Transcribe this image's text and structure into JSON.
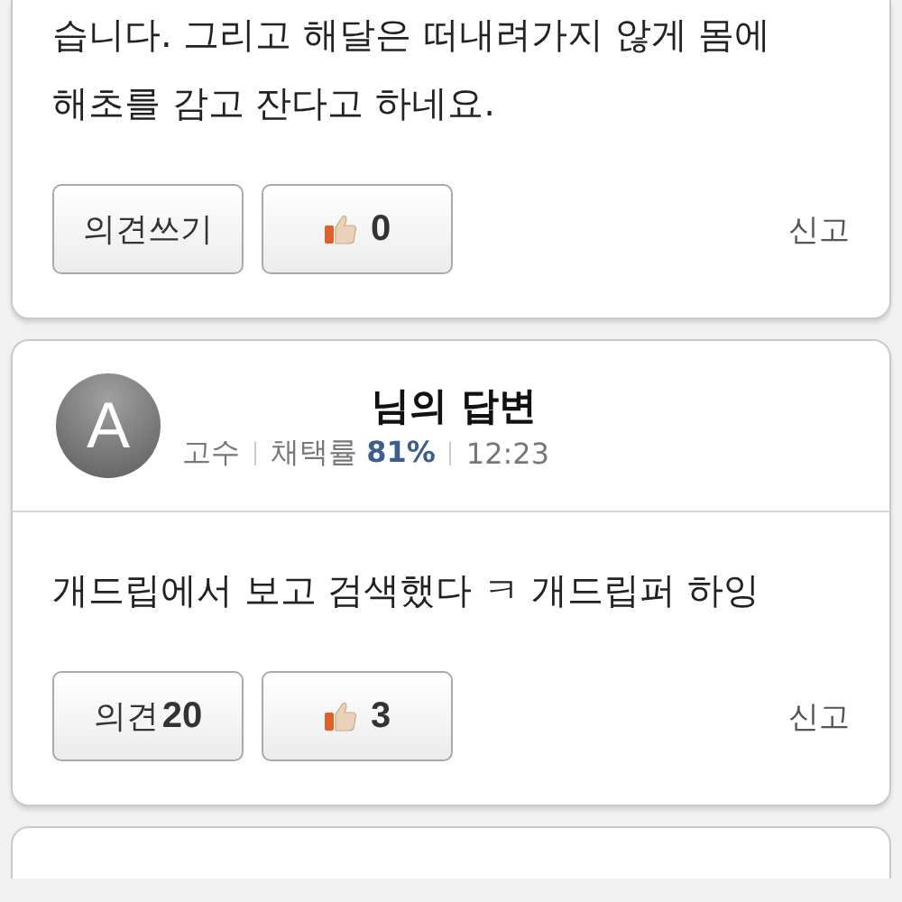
{
  "answers": [
    {
      "body": "습니다. 그리고 해달은 떠내려가지 않게 몸에\n해초를 감고 잔다고 하네요.",
      "comment_button": {
        "label": "의견쓰기"
      },
      "like_button": {
        "count": "0"
      },
      "report": "신고"
    },
    {
      "author": {
        "avatar": "A",
        "title": "님의 답변",
        "rank": "고수",
        "rate_label": "채택률",
        "rate": "81%",
        "time": "12:23"
      },
      "body": "개드립에서 보고 검색했다 ㅋ 개드립퍼 하잉",
      "comment_button": {
        "label": "의견",
        "count": "20"
      },
      "like_button": {
        "count": "3"
      },
      "report": "신고"
    }
  ]
}
